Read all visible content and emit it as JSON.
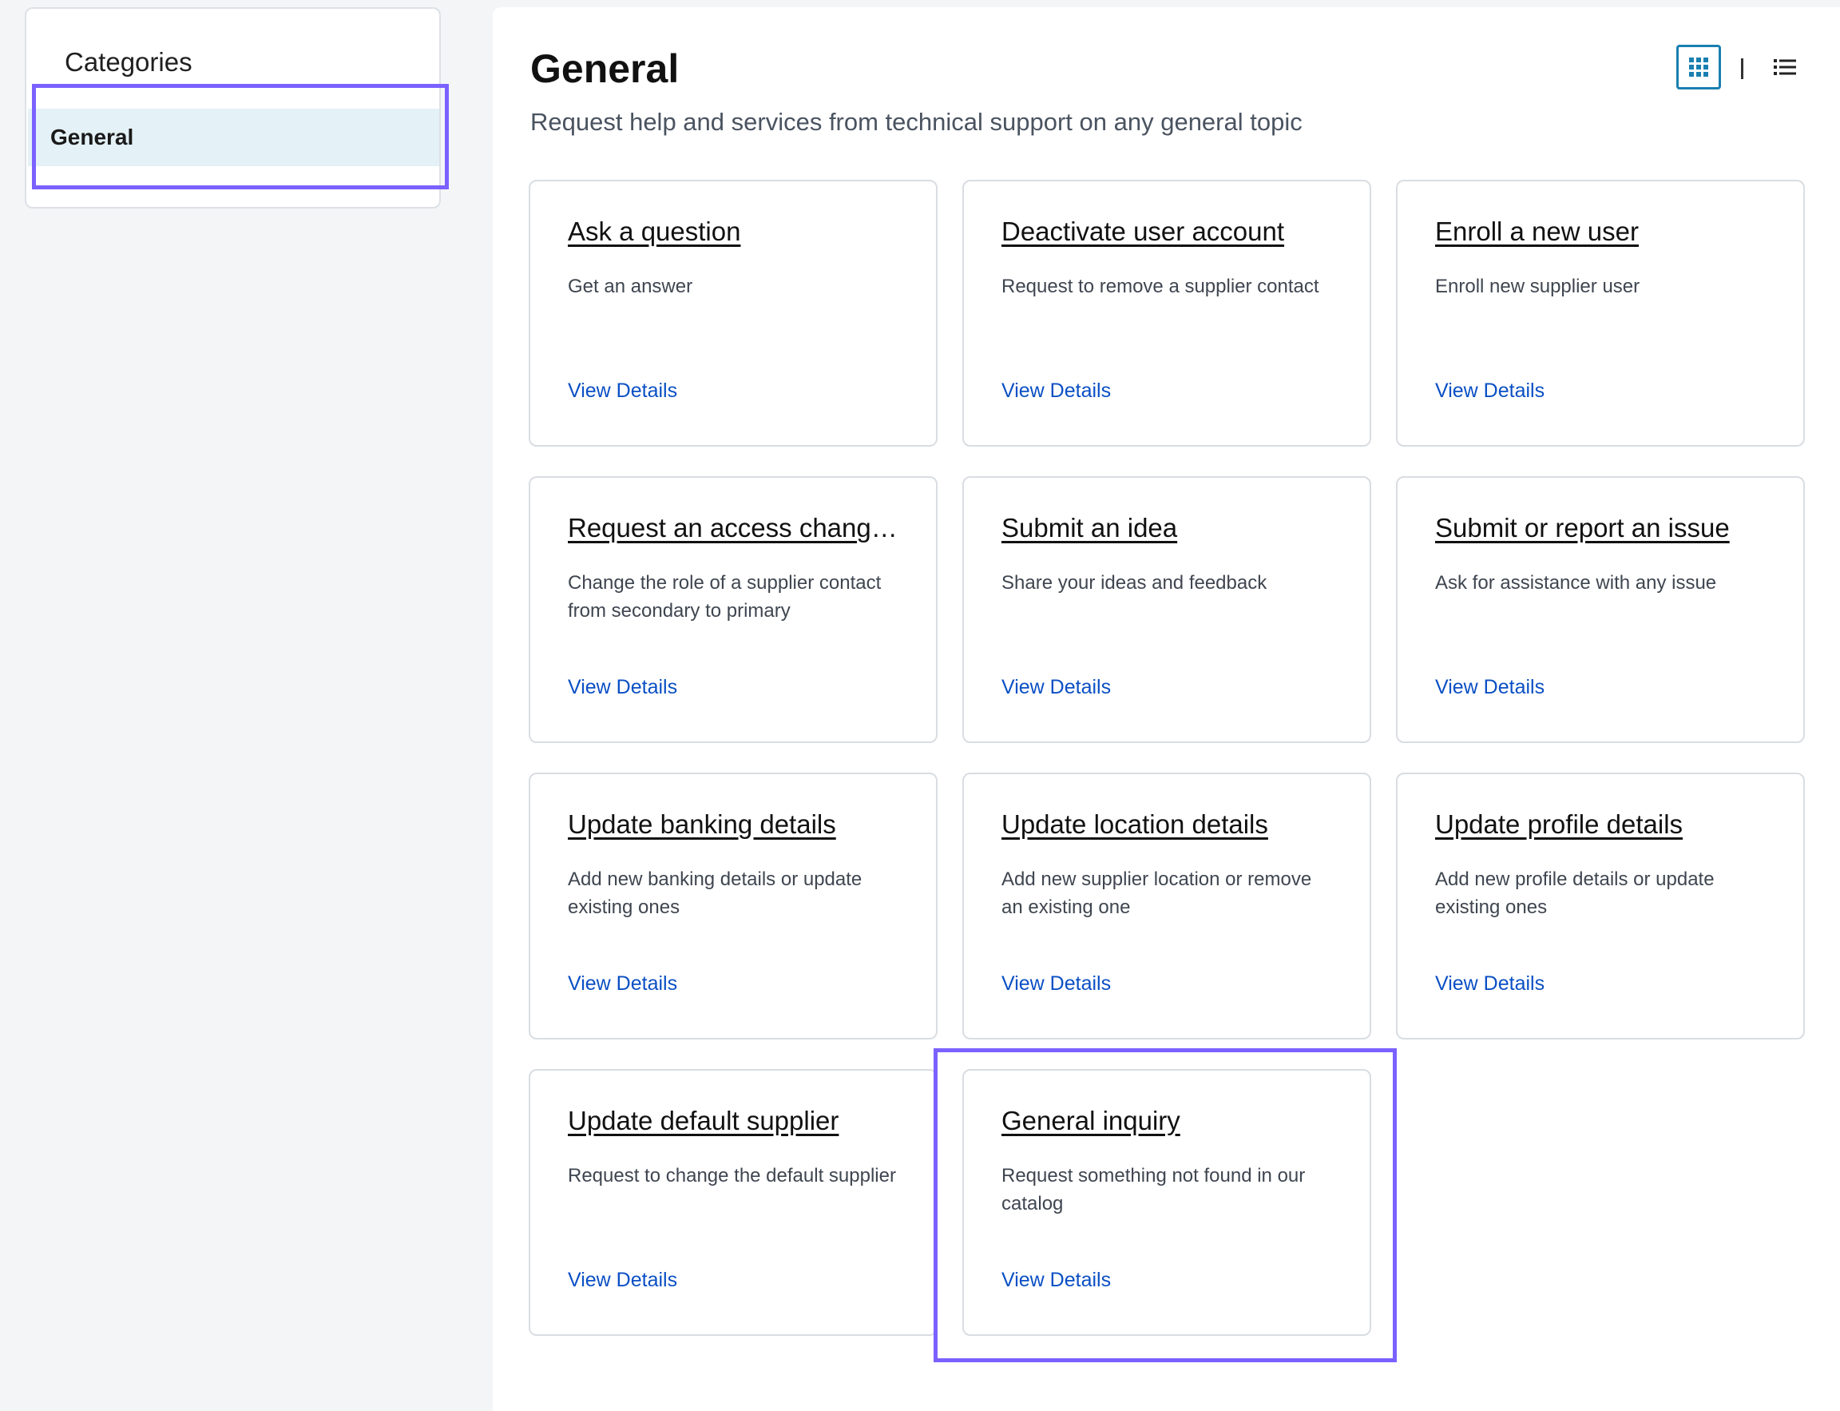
{
  "sidebar": {
    "title": "Categories",
    "items": [
      {
        "label": "General",
        "selected": true
      }
    ]
  },
  "main": {
    "title": "General",
    "subtitle": "Request help and services from technical support on any general topic",
    "view_modes": [
      "grid-icon",
      "list-icon"
    ],
    "active_view": "grid"
  },
  "cards": [
    {
      "title": "Ask a question",
      "description": "Get an answer",
      "link": "View Details"
    },
    {
      "title": "Deactivate user account",
      "description": "Request to remove a supplier contact",
      "link": "View Details"
    },
    {
      "title": "Enroll a new user",
      "description": "Enroll new supplier user",
      "link": "View Details"
    },
    {
      "title": "Request an access change r...",
      "description": "Change the role of a supplier contact from secondary to primary",
      "link": "View Details"
    },
    {
      "title": "Submit an idea",
      "description": "Share your ideas and feedback",
      "link": "View Details"
    },
    {
      "title": "Submit or report an issue",
      "description": "Ask for assistance with any issue",
      "link": "View Details"
    },
    {
      "title": "Update banking details",
      "description": "Add new banking details or update existing ones",
      "link": "View Details"
    },
    {
      "title": "Update location details",
      "description": "Add new supplier location or remove an existing one",
      "link": "View Details"
    },
    {
      "title": "Update profile details",
      "description": "Add new profile details or update existing ones",
      "link": "View Details"
    },
    {
      "title": "Update default supplier",
      "description": "Request to change the default supplier",
      "link": "View Details"
    },
    {
      "title": "General inquiry",
      "description": "Request something not found in our catalog",
      "link": "View Details"
    }
  ],
  "colors": {
    "accent_highlight": "#7b61ff",
    "link": "#0a4fc4",
    "selected_bg": "#e4f1f6",
    "toggle_active": "#1a7fb0"
  }
}
